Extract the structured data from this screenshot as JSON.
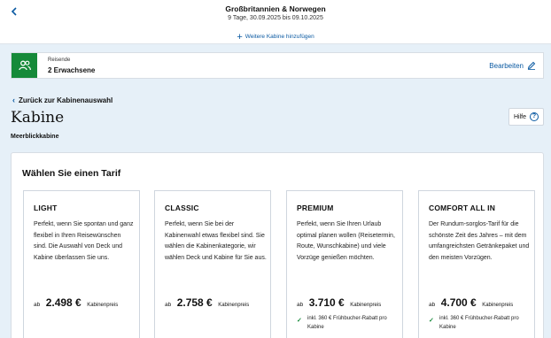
{
  "header": {
    "back_icon": "chevron-left-icon",
    "title": "Großbritannien & Norwegen",
    "dates": "9 Tage, 30.09.2025 bis 09.10.2025",
    "add_cabin_label": "Weitere Kabine hinzufügen"
  },
  "travellers": {
    "icon": "group-icon",
    "label": "Reisende",
    "value": "2 Erwachsene",
    "edit_label": "Bearbeiten",
    "edit_icon": "pencil-icon"
  },
  "navigation": {
    "back_label": "Zurück zur Kabinenauswahl"
  },
  "cabin": {
    "title": "Kabine",
    "subtitle": "Meerblickkabine",
    "help_label": "Hilfe"
  },
  "tariffs": {
    "heading": "Wählen Sie einen Tarif",
    "items": [
      {
        "name": "LIGHT",
        "description": "Perfekt, wenn Sie spontan und ganz flexibel in Ihren Reisewünschen sind. Die Auswahl von Deck und Kabine überlassen Sie uns.",
        "price_prefix": "ab",
        "price": "2.498 €",
        "price_unit": "Kabinenpreis",
        "benefit": ""
      },
      {
        "name": "CLASSIC",
        "description": "Perfekt, wenn Sie bei der Kabinenwahl etwas flexibel sind. Sie wählen die Kabinenkategorie, wir wählen Deck und Kabine für Sie aus.",
        "price_prefix": "ab",
        "price": "2.758 €",
        "price_unit": "Kabinenpreis",
        "benefit": ""
      },
      {
        "name": "PREMIUM",
        "description": "Perfekt, wenn Sie Ihren Urlaub optimal planen wollen (Reisetermin, Route, Wunschkabine) und viele Vorzüge genießen möchten.",
        "price_prefix": "ab",
        "price": "3.710 €",
        "price_unit": "Kabinenpreis",
        "benefit": "inkl. 360 € Frühbucher-Rabatt pro Kabine"
      },
      {
        "name": "COMFORT ALL IN",
        "description": "Der Rundum-sorglos-Tarif für die schönste Zeit des Jahres – mit dem umfangreichsten Getränkepaket und den meisten Vorzügen.",
        "price_prefix": "ab",
        "price": "4.700 €",
        "price_unit": "Kabinenpreis",
        "benefit": "inkl. 360 € Frühbucher-Rabatt pro Kabine"
      }
    ]
  },
  "colors": {
    "accent": "#0b5aa2",
    "brand_green": "#168a39",
    "background": "#e6f0f8"
  }
}
